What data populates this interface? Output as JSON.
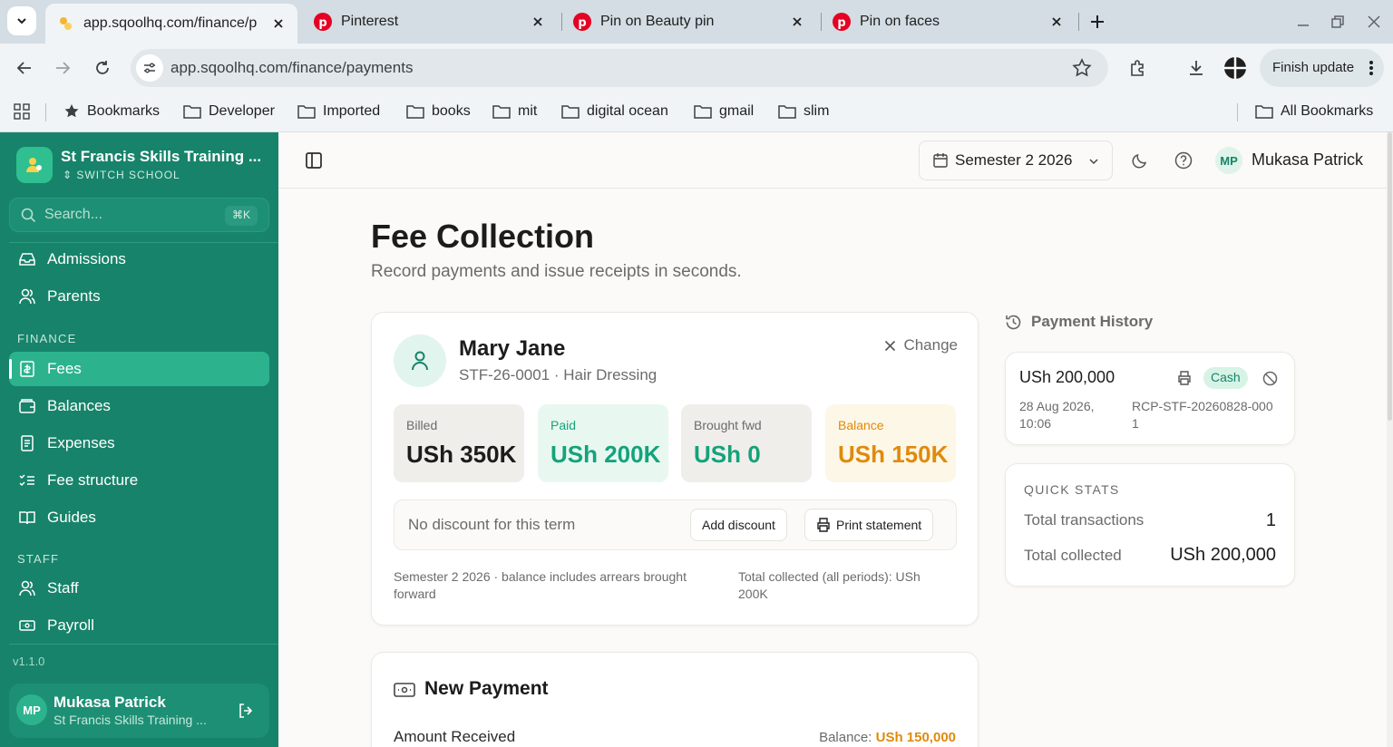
{
  "browser": {
    "tabs": [
      {
        "title": "app.sqoolhq.com/finance/p",
        "active": true
      },
      {
        "title": "Pinterest",
        "active": false
      },
      {
        "title": "Pin on Beauty pin",
        "active": false
      },
      {
        "title": "Pin on faces",
        "active": false
      }
    ],
    "url": "app.sqoolhq.com/finance/payments",
    "finish_update": "Finish update",
    "bookmarks": [
      "Bookmarks",
      "Developer",
      "Imported",
      "books",
      "mit",
      "digital ocean",
      "gmail",
      "slim"
    ],
    "all_bookmarks": "All Bookmarks"
  },
  "sidebar": {
    "school_name": "St Francis Skills Training ...",
    "switch_label": "SWITCH SCHOOL",
    "search_placeholder": "Search...",
    "search_shortcut": "⌘K",
    "top_items": [
      {
        "label": "Admissions",
        "icon": "inbox-icon"
      },
      {
        "label": "Parents",
        "icon": "users-icon"
      }
    ],
    "finance_section": "FINANCE",
    "finance_items": [
      {
        "label": "Fees",
        "icon": "receipt-icon",
        "active": true
      },
      {
        "label": "Balances",
        "icon": "wallet-icon"
      },
      {
        "label": "Expenses",
        "icon": "document-icon"
      },
      {
        "label": "Fee structure",
        "icon": "list-checks-icon"
      },
      {
        "label": "Guides",
        "icon": "book-icon"
      }
    ],
    "staff_section": "STAFF",
    "staff_items": [
      {
        "label": "Staff",
        "icon": "users-icon"
      },
      {
        "label": "Payroll",
        "icon": "banknote-icon"
      }
    ],
    "version": "v1.1.0",
    "user": {
      "initials": "MP",
      "name": "Mukasa Patrick",
      "school": "St Francis Skills Training ..."
    }
  },
  "header": {
    "semester": "Semester 2 2026",
    "user_initials": "MP",
    "user_name": "Mukasa Patrick"
  },
  "page": {
    "title": "Fee Collection",
    "subtitle": "Record payments and issue receipts in seconds."
  },
  "student": {
    "name": "Mary Jane",
    "meta": "STF-26-0001 · Hair Dressing",
    "change_label": "Change",
    "stats": [
      {
        "label": "Billed",
        "value": "USh 350K"
      },
      {
        "label": "Paid",
        "value": "USh 200K"
      },
      {
        "label": "Brought fwd",
        "value": "USh 0"
      },
      {
        "label": "Balance",
        "value": "USh 150K"
      }
    ],
    "discount_text": "No discount for this term",
    "add_discount": "Add discount",
    "print_statement": "Print statement",
    "note_left": "Semester 2 2026 · balance includes arrears brought forward",
    "note_right": "Total collected (all periods): USh 200K"
  },
  "new_payment": {
    "title": "New Payment",
    "amount_label": "Amount Received",
    "balance_prefix": "Balance: ",
    "balance_value": "USh 150,000"
  },
  "payment_history": {
    "title": "Payment History",
    "entries": [
      {
        "amount": "USh 200,000",
        "method": "Cash",
        "date": "28 Aug 2026, 10:06",
        "receipt": "RCP-STF-20260828-0001"
      }
    ]
  },
  "quick_stats": {
    "title": "QUICK STATS",
    "rows": [
      {
        "label": "Total transactions",
        "value": "1"
      },
      {
        "label": "Total collected",
        "value": "USh 200,000"
      }
    ]
  },
  "colors": {
    "sidebar_bg": "#17836a",
    "sidebar_active": "#2cb38e",
    "paid_green": "#14a37a",
    "balance_orange": "#e08a0b"
  }
}
